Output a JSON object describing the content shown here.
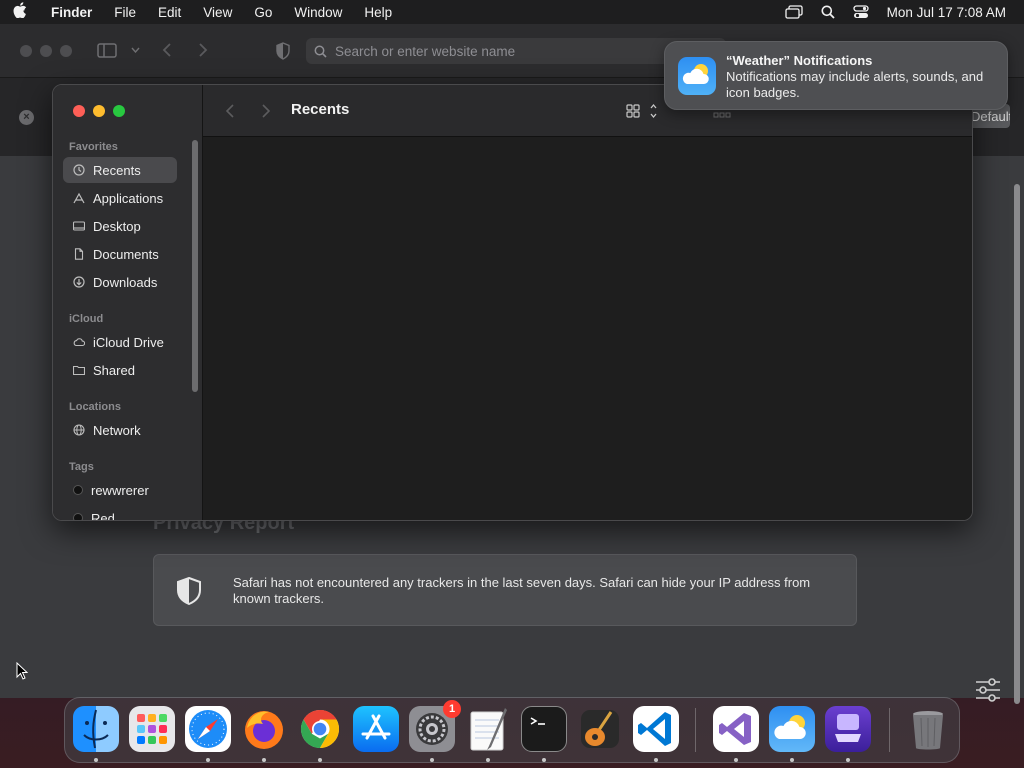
{
  "menubar": {
    "app_name": "Finder",
    "menus": [
      "File",
      "Edit",
      "View",
      "Go",
      "Window",
      "Help"
    ],
    "datetime": "Mon Jul 17  7:08 AM"
  },
  "safari": {
    "address_placeholder": "Search or enter website name",
    "default_button": "Default",
    "privacy_title": "Privacy Report",
    "privacy_text": "Safari has not encountered any trackers in the last seven days. Safari can hide your IP address from known trackers."
  },
  "notification": {
    "title": "“Weather” Notifications",
    "body": "Notifications may include alerts, sounds, and icon badges."
  },
  "finder": {
    "window_title": "Recents",
    "sidebar": {
      "favorites_header": "Favorites",
      "favorites": [
        {
          "label": "Recents",
          "icon": "clock-icon"
        },
        {
          "label": "Applications",
          "icon": "applications-icon"
        },
        {
          "label": "Desktop",
          "icon": "desktop-icon"
        },
        {
          "label": "Documents",
          "icon": "document-icon"
        },
        {
          "label": "Downloads",
          "icon": "download-icon"
        }
      ],
      "icloud_header": "iCloud",
      "icloud": [
        {
          "label": "iCloud Drive",
          "icon": "cloud-icon"
        },
        {
          "label": "Shared",
          "icon": "shared-folder-icon"
        }
      ],
      "locations_header": "Locations",
      "locations": [
        {
          "label": "Network",
          "icon": "globe-icon"
        }
      ],
      "tags_header": "Tags",
      "tags": [
        {
          "label": "rewwrerer",
          "color": "#111111"
        },
        {
          "label": "Red",
          "color": "#111111"
        }
      ]
    }
  },
  "dock": {
    "apps": [
      "Finder",
      "Launchpad",
      "Safari",
      "Firefox",
      "Chrome",
      "App Store",
      "System Settings",
      "TextEdit",
      "Terminal",
      "GarageBand",
      "Visual Studio Code",
      "Visual Studio",
      "Weather",
      "Simulator",
      "Trash"
    ],
    "settings_badge": "1"
  },
  "colors": {
    "accent_red": "#fe5f57",
    "accent_yellow": "#febc2e",
    "accent_green": "#28c840",
    "badge_red": "#ff3b30"
  }
}
